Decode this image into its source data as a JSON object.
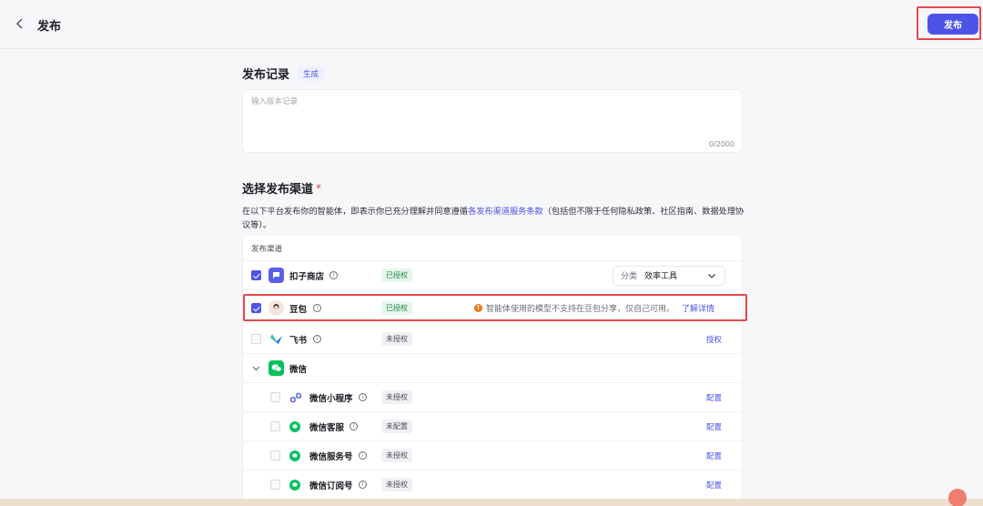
{
  "header": {
    "title": "发布",
    "publish_label": "发布"
  },
  "record": {
    "title": "发布记录",
    "generate_label": "生成",
    "placeholder": "输入版本记录",
    "char_count": "0/2000"
  },
  "channels": {
    "title": "选择发布渠道",
    "required_mark": "*",
    "desc_prefix": "在以下平台发布你的智能体，即表示你已充分理解并同意遵循",
    "desc_link": "各发布渠道服务条款",
    "desc_suffix": "（包括但不限于任何隐私政策、社区指南、数据处理协议等）。",
    "table_header": "发布渠道",
    "koz": {
      "name": "扣子商店",
      "status": "已授权",
      "category_label": "分类",
      "category_value": "效率工具"
    },
    "doubao": {
      "name": "豆包",
      "status": "已授权",
      "warning": "智能体使用的模型不支持在豆包分享，仅自己可用。",
      "warning_link": "了解详情"
    },
    "feishu": {
      "name": "飞书",
      "status": "未授权",
      "action": "授权"
    },
    "wechat": {
      "name": "微信",
      "items": [
        {
          "name": "微信小程序",
          "status": "未授权",
          "action": "配置"
        },
        {
          "name": "微信客服",
          "status": "未配置",
          "action": "配置"
        },
        {
          "name": "微信服务号",
          "status": "未授权",
          "action": "配置"
        },
        {
          "name": "微信订阅号",
          "status": "未授权",
          "action": "配置"
        }
      ]
    }
  },
  "colors": {
    "accent": "#4d53e8",
    "highlight_border": "#e5484d",
    "authorized_bg": "#e7f7ec",
    "authorized_text": "#1e8a45",
    "warning": "#f07b16",
    "wechat_green": "#07c160"
  },
  "icons": {
    "back": "chevron-left-icon",
    "info": "info-icon",
    "dropdown": "chevron-down-icon",
    "expand": "chevron-down-icon",
    "warning": "warning-icon"
  }
}
